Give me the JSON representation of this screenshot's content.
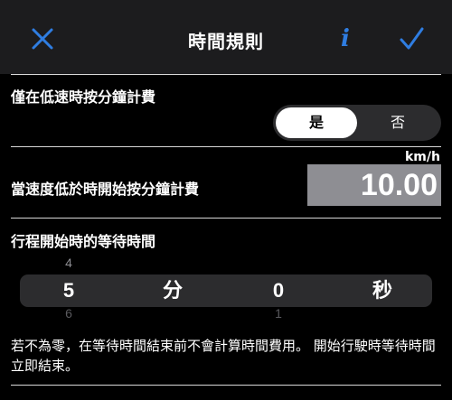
{
  "nav": {
    "title": "時間規則",
    "info_label": "i",
    "close_icon": "close-icon",
    "done_icon": "checkmark-icon",
    "accent_color": "#2f7de1"
  },
  "rule1": {
    "label": "僅在低速時按分鐘計費",
    "options": [
      "是",
      "否"
    ],
    "selected": "是"
  },
  "rule2": {
    "label": "當速度低於時開始按分鐘計費",
    "unit": "km/h",
    "value": "10.00"
  },
  "rule3": {
    "label": "行程開始時的等待時間",
    "minutes": {
      "above": "4",
      "selected": "5",
      "below": "6",
      "unit": "分"
    },
    "seconds": {
      "selected": "0",
      "below": "1",
      "unit": "秒"
    }
  },
  "note": "若不為零，在等待時間結束前不會計算時間費用。 開始行駛時等待時間立即結束。"
}
